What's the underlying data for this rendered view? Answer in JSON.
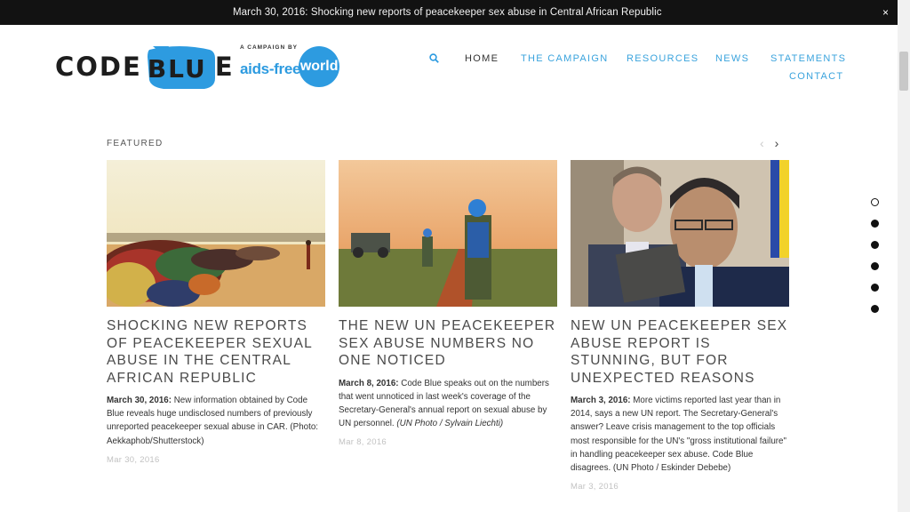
{
  "announcement": {
    "text": "March 30, 2016: Shocking new reports of peacekeeper sex abuse in Central African Republic",
    "close": "×"
  },
  "logo": {
    "prefix": "CODE",
    "bubble": "BLU",
    "suffix": "E"
  },
  "partner": {
    "small": "A CAMPAIGN BY",
    "aids": "aids-free",
    "world": "world"
  },
  "nav": {
    "items": [
      {
        "label": "HOME"
      },
      {
        "label": "THE CAMPAIGN"
      },
      {
        "label": "RESOURCES"
      },
      {
        "label": "NEWS"
      },
      {
        "label": "STATEMENTS"
      },
      {
        "label": "CONTACT"
      }
    ]
  },
  "featured": {
    "label": "FEATURED",
    "prev": "‹",
    "next": "›",
    "cards": [
      {
        "title": "SHOCKING NEW REPORTS OF PEACEKEEPER SEXUAL ABUSE IN THE CENTRAL AFRICAN REPUBLIC",
        "lead": "March 30, 2016:",
        "body": " New information obtained by Code Blue reveals huge undisclosed numbers of previously unreported peacekeeper sexual abuse in CAR. (Photo: Aekkaphob/Shutterstock)",
        "date": "Mar 30, 2016"
      },
      {
        "title": "THE NEW UN PEACEKEEPER SEX ABUSE NUMBERS NO ONE NOTICED",
        "lead": "March 8, 2016:",
        "body": " Code Blue speaks out on the numbers that went unnoticed in last week's coverage of the Secretary-General's annual report on sexual abuse by UN personnel.",
        "credit": "(UN Photo / Sylvain Liechti)",
        "date": "Mar 8, 2016"
      },
      {
        "title": "NEW UN PEACEKEEPER SEX ABUSE REPORT IS STUNNING, BUT FOR UNEXPECTED REASONS",
        "lead": "March 3, 2016:",
        "body": " More victims reported last year than in 2014, says a new UN report. The Secretary-General's answer? Leave crisis management to the top officials most responsible for the UN's \"gross institutional failure\" in handling peacekeeper sex abuse. Code Blue disagrees. (UN Photo / Eskinder Debebe)",
        "date": "Mar 3, 2016"
      }
    ]
  },
  "pager": {
    "count": 6,
    "active": 0
  },
  "colors": {
    "accent": "#2d9be0",
    "topbar": "#121212",
    "nav": "#3aa3dd"
  }
}
